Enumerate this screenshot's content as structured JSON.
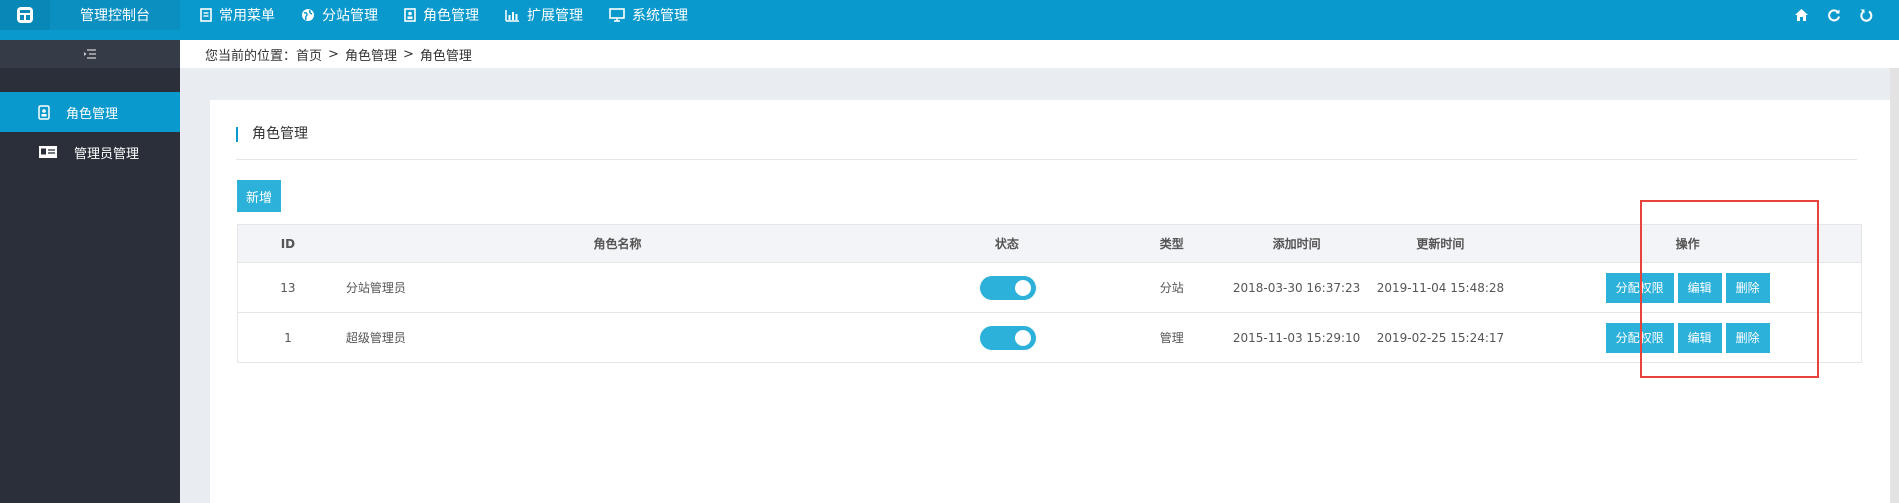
{
  "header": {
    "brand": "管理控制台",
    "nav": [
      {
        "label": "常用菜单",
        "icon": "document-icon"
      },
      {
        "label": "分站管理",
        "icon": "globe-icon"
      },
      {
        "label": "角色管理",
        "icon": "role-card-icon"
      },
      {
        "label": "扩展管理",
        "icon": "bar-chart-icon"
      },
      {
        "label": "系统管理",
        "icon": "monitor-icon"
      }
    ],
    "right_icons": [
      "home-icon",
      "refresh-icon",
      "logout-icon"
    ]
  },
  "sidebar": {
    "items": [
      {
        "label": "角色管理",
        "icon": "badge-icon",
        "active": true
      },
      {
        "label": "管理员管理",
        "icon": "id-card-icon",
        "active": false
      }
    ]
  },
  "breadcrumb": {
    "prefix": "您当前的位置：",
    "items": [
      "首页",
      "角色管理",
      "角色管理"
    ],
    "separator": ">"
  },
  "card": {
    "title": "角色管理",
    "add_label": "新增"
  },
  "table": {
    "headers": [
      "ID",
      "角色名称",
      "状态",
      "类型",
      "添加时间",
      "更新时间",
      "操作"
    ],
    "rows": [
      {
        "id": "13",
        "name": "分站管理员",
        "enabled": true,
        "type": "分站",
        "created": "2018-03-30 16:37:23",
        "updated": "2019-11-04 15:48:28"
      },
      {
        "id": "1",
        "name": "超级管理员",
        "enabled": true,
        "type": "管理",
        "created": "2015-11-03 15:29:10",
        "updated": "2019-02-25 15:24:17"
      }
    ],
    "actions": {
      "grant": "分配权限",
      "edit": "编辑",
      "delete": "删除"
    }
  },
  "colors": {
    "topbar": "#0a99cc",
    "sidebar": "#2a2f3a",
    "accent": "#2cb1da",
    "highlight": "#e8433a"
  }
}
